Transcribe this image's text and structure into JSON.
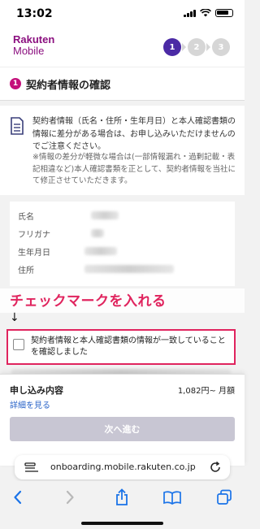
{
  "status": {
    "time": "13:02"
  },
  "header": {
    "logo_line1": "Rakuten",
    "logo_line2": "Mobile",
    "steps": [
      "1",
      "2",
      "3"
    ]
  },
  "section": {
    "number": "1",
    "title": "契約者情報の確認"
  },
  "notice": {
    "main": "契約者情報（氏名・住所・生年月日）と本人確認書類の情報に差分がある場合は、お申し込みいただけませんのでご注意ください。",
    "sub": "※情報の差分が軽微な場合は(一部情報漏れ・過剰記載・表記相違など)本人確認書類を正として、契約者情報を当社にて修正させていただきます。"
  },
  "info": {
    "labels": [
      "氏名",
      "フリガナ",
      "生年月日",
      "住所"
    ]
  },
  "annotation": {
    "callout": "チェックマークを入れる",
    "arrow": "↓"
  },
  "confirm": {
    "label": "契約者情報と本人確認書類の情報が一致していることを確認しました",
    "checked": false
  },
  "summary": {
    "title": "申し込み内容",
    "price": "1,082円~ 月額",
    "detail_link": "詳細を見る",
    "next_button": "次へ進む"
  },
  "browser": {
    "url": "onboarding.mobile.rakuten.co.jp"
  },
  "colors": {
    "brand": "#8b0f7f",
    "step_active": "#4b2aa5",
    "accent": "#e0245e"
  }
}
